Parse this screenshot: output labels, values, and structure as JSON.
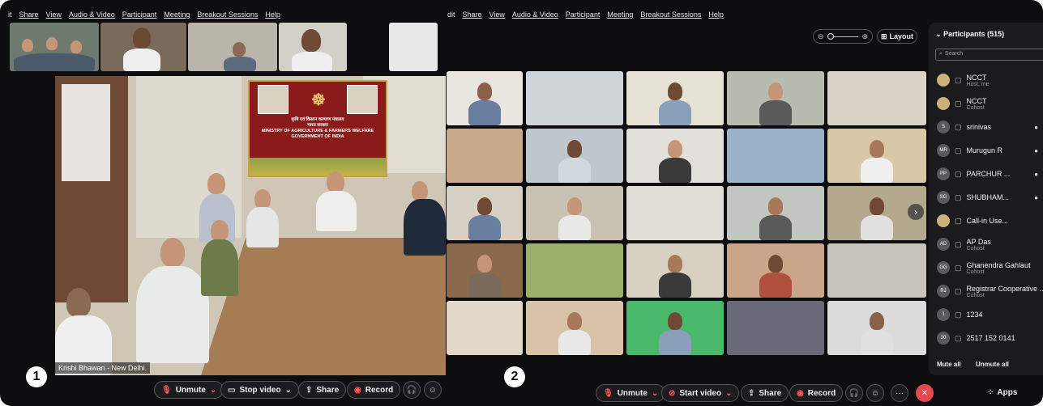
{
  "left_window": {
    "menu": [
      "Share",
      "View",
      "Audio & Video",
      "Participant",
      "Meeting",
      "Breakout Sessions",
      "Help"
    ],
    "menu_lead": "it",
    "video_label": "Krishi Bhawan - New Delhi.",
    "banner": {
      "hindi_line1": "कृषि एवं किसान कल्याण मंत्रालय",
      "hindi_line2": "भारत सरकार",
      "line1": "MINISTRY OF AGRICULTURE & FARMERS WELFARE",
      "line2": "GOVERNMENT OF INDIA"
    },
    "toolbar": {
      "unmute": "Unmute",
      "stop_video": "Stop video",
      "share": "Share",
      "record": "Record"
    },
    "marker": "1"
  },
  "right_window": {
    "menu": [
      "Share",
      "View",
      "Audio & Video",
      "Participant",
      "Meeting",
      "Breakout Sessions",
      "Help"
    ],
    "menu_lead": "dit",
    "layout_label": "Layout",
    "toolbar": {
      "unmute": "Unmute",
      "start_video": "Start video",
      "share": "Share",
      "record": "Record",
      "apps": "Apps"
    },
    "marker": "2"
  },
  "participants": {
    "title": "Participants (515)",
    "search_placeholder": "Search",
    "list": [
      {
        "initials": "",
        "name": "NCCT",
        "sub": "Host, me"
      },
      {
        "initials": "",
        "name": "NCCT",
        "sub": "Cohost"
      },
      {
        "initials": "S",
        "name": "srinivas",
        "sub": ""
      },
      {
        "initials": "MR",
        "name": "Murugun R",
        "sub": ""
      },
      {
        "initials": "PP",
        "name": "PARCHUR ...",
        "sub": ""
      },
      {
        "initials": "SG",
        "name": "SHUBHAM...",
        "sub": ""
      },
      {
        "initials": "",
        "name": "Call-in Use...",
        "sub": ""
      },
      {
        "initials": "AD",
        "name": "AP Das",
        "sub": "Cohost"
      },
      {
        "initials": "GG",
        "name": "Ghanendra Gahlaut",
        "sub": "Cohost"
      },
      {
        "initials": "RJ",
        "name": "Registrar Cooperative ...",
        "sub": "Cohost"
      },
      {
        "initials": "1",
        "name": "1234",
        "sub": ""
      },
      {
        "initials": "20",
        "name": "2517 152 0141",
        "sub": ""
      }
    ],
    "mute_all": "Mute all",
    "unmute_all": "Unmute all"
  },
  "colors": {
    "red": "#e5484d",
    "banner": "#8b1a1a",
    "panel": "#1b1b1d"
  }
}
